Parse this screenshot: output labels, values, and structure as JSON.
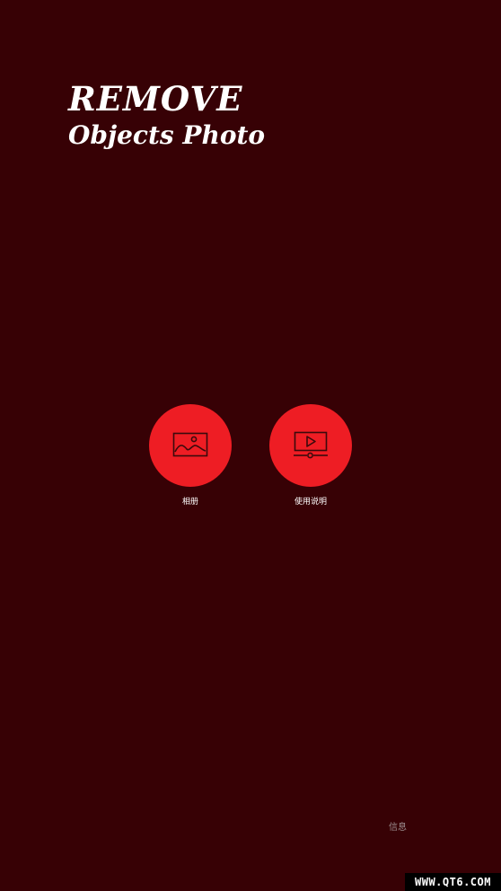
{
  "header": {
    "title_line1": "REMOVE",
    "title_line2": "Objects Photo"
  },
  "actions": [
    {
      "label": "相册",
      "icon": "image-icon"
    },
    {
      "label": "使用说明",
      "icon": "video-play-icon"
    }
  ],
  "footer": {
    "info_label": "信息"
  },
  "watermark": {
    "text": "WWW.QT6.COM"
  },
  "colors": {
    "background": "#370105",
    "accent": "#ee1d24",
    "icon_stroke": "#3a0a0c"
  }
}
